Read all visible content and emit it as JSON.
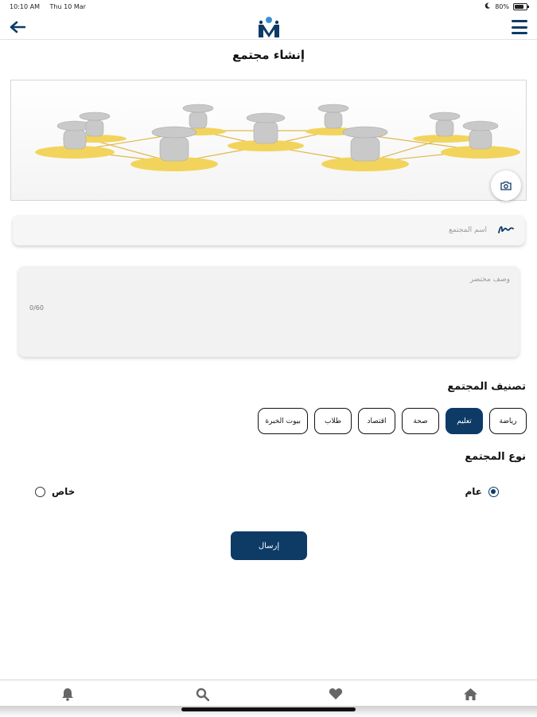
{
  "status_bar": {
    "time": "10:10 AM",
    "date": "Thu 10 Mar",
    "battery": "80%",
    "battery_level": 0.8
  },
  "header": {
    "back_icon": "arrow-left-icon",
    "menu_icon": "hamburger-menu-icon",
    "logo_icon": "app-logo",
    "brand_color": "#0d3b66"
  },
  "page": {
    "title": "إنشاء مجتمع"
  },
  "cover_image": {
    "description_icon": "network-people-image",
    "camera_icon": "camera-icon"
  },
  "form": {
    "name_placeholder": "اسم المجتمع",
    "name_value": "",
    "name_icon": "signature-icon",
    "description_placeholder": "وصف مختصر",
    "description_value": "",
    "description_counter": "0/60",
    "category_label": "تصنيف المجتمع",
    "categories": [
      {
        "label": "رياضة",
        "selected": false
      },
      {
        "label": "تعليم",
        "selected": true
      },
      {
        "label": "صحة",
        "selected": false
      },
      {
        "label": "اقتصاد",
        "selected": false
      },
      {
        "label": "طلاب",
        "selected": false
      },
      {
        "label": "بيوت الخبرة",
        "selected": false
      }
    ],
    "type_label": "نوع المجتمع",
    "types": [
      {
        "label": "عام",
        "checked": true
      },
      {
        "label": "خاص",
        "checked": false
      }
    ],
    "submit_label": "إرسال"
  },
  "bottom_nav": {
    "items": [
      "bell-icon",
      "search-icon",
      "heart-icon",
      "home-icon"
    ]
  }
}
